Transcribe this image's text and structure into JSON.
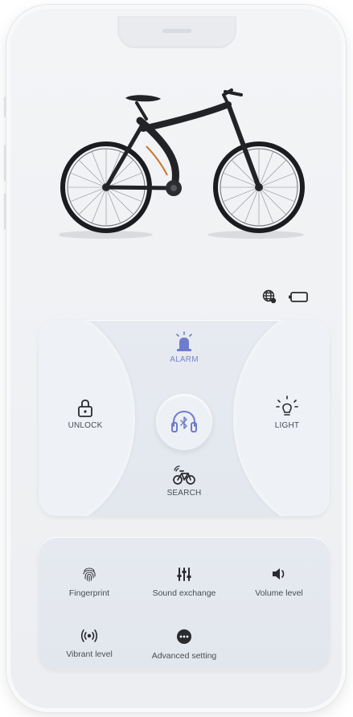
{
  "status_bar": {
    "globe_icon": "globe-icon",
    "battery_icon": "battery-icon"
  },
  "controls": {
    "alarm": {
      "label": "ALARM",
      "icon": "alarm-siren-icon",
      "accent": "#7a86c9"
    },
    "unlock": {
      "label": "UNLOCK",
      "icon": "lock-icon"
    },
    "light": {
      "label": "LIGHT",
      "icon": "lightbulb-icon"
    },
    "search": {
      "label": "SEARCH",
      "icon": "bike-signal-icon"
    },
    "connect": {
      "icon": "bluetooth-headphones-icon",
      "accent": "#7a86c9"
    }
  },
  "settings": [
    {
      "label": "Fingerprint",
      "icon": "fingerprint-icon"
    },
    {
      "label": "Sound exchange",
      "icon": "equalizer-icon"
    },
    {
      "label": "Volume level",
      "icon": "speaker-icon"
    },
    {
      "label": "Vibrant level",
      "icon": "vibration-icon"
    },
    {
      "label": "Advanced setting",
      "icon": "more-dots-icon"
    }
  ]
}
